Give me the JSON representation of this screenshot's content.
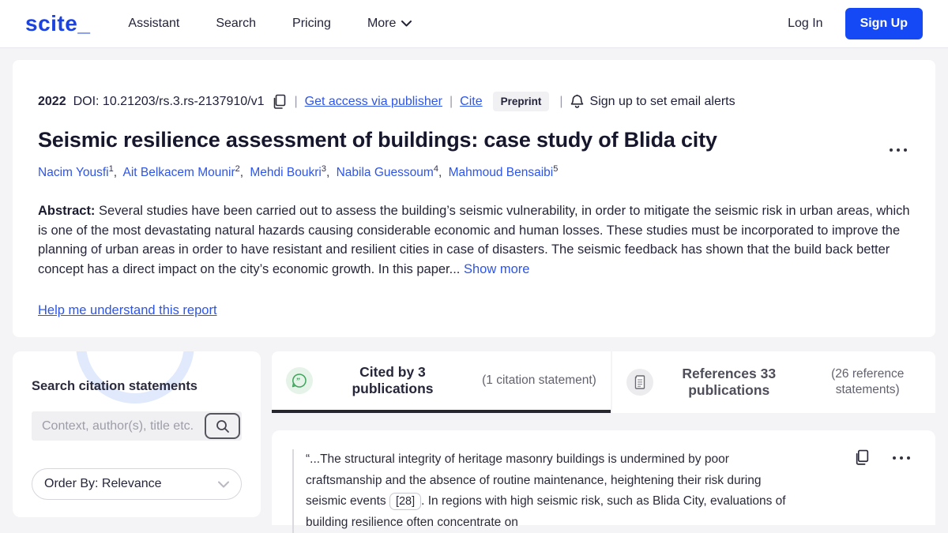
{
  "brand": {
    "logo": "scite_",
    "accent_blue": "#1549f5",
    "logo_blue": "#1c43e0",
    "link_blue": "#2d55e8",
    "quote_green": "#3fa45c"
  },
  "nav": {
    "items": {
      "assistant": "Assistant",
      "search": "Search",
      "pricing": "Pricing",
      "more": "More"
    },
    "login": "Log In",
    "signup": "Sign Up"
  },
  "paper": {
    "year": "2022",
    "doi": "DOI: 10.21203/rs.3.rs-2137910/v1",
    "sep": "|",
    "access_link": "Get access via publisher",
    "cite_link": "Cite",
    "badge": "Preprint",
    "alerts": "Sign up to set email alerts",
    "title": "Seismic resilience assessment of buildings: case study of Blida city",
    "author_sep": ",",
    "authors": [
      {
        "name": "Nacim Yousfi",
        "sup": "1"
      },
      {
        "name": "Ait Belkacem Mounir",
        "sup": "2"
      },
      {
        "name": "Mehdi Boukri",
        "sup": "3"
      },
      {
        "name": "Nabila Guessoum",
        "sup": "4"
      },
      {
        "name": "Mahmoud Bensaibi",
        "sup": "5"
      }
    ],
    "abstract_label": "Abstract:",
    "abstract_text": " Several studies have been carried out to assess the building’s seismic vulnerability, in order to mitigate the seismic risk in urban areas, which is one of the most devastating natural hazards causing considerable economic and human losses. These studies must be incorporated to improve the planning of urban areas in order to have resistant and resilient cities in case of disasters. The seismic feedback has shown that the build back better concept has a direct impact on the city’s economic growth. In this paper... ",
    "show_more": "Show more",
    "help_link": "Help me understand this report"
  },
  "sidebar": {
    "heading": "Search citation statements",
    "search_placeholder": "Context, author(s), title etc.",
    "order_by": "Order By: Relevance"
  },
  "tabs": {
    "cited": {
      "label": "Cited by 3 publications",
      "note": "(1 citation statement)"
    },
    "references": {
      "label": "References 33 publications",
      "note": "(26 reference statements)"
    }
  },
  "citation": {
    "text_before": "“...The structural integrity of heritage masonry buildings is undermined by poor craftsmanship and the absence of routine maintenance, heightening their risk during seismic events ",
    "ref": "[28]",
    "text_after": ". In regions with high seismic risk, such as Blida City, evaluations of building resilience often concentrate on"
  }
}
